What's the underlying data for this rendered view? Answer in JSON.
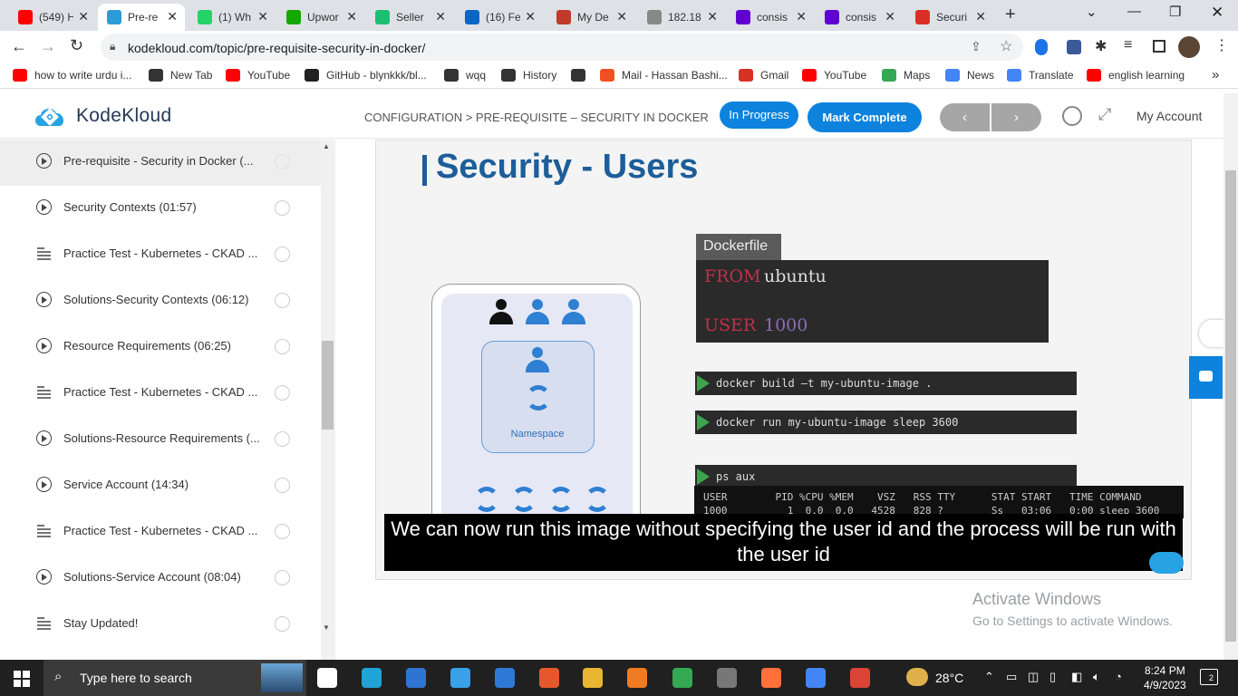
{
  "browser": {
    "tabs": [
      {
        "title": "(549) H",
        "fav": "youtube",
        "color": "#ff0000"
      },
      {
        "title": "Pre-re",
        "fav": "kodekloud",
        "color": "#2b9cd8",
        "active": true
      },
      {
        "title": "(1) Wh",
        "fav": "whatsapp",
        "color": "#25d366"
      },
      {
        "title": "Upwor",
        "fav": "upwork",
        "color": "#14a800"
      },
      {
        "title": "Seller",
        "fav": "fiverr",
        "color": "#1dbf73"
      },
      {
        "title": "(16) Fe",
        "fav": "linkedin",
        "color": "#0a66c2"
      },
      {
        "title": "My De",
        "fav": "site",
        "color": "#c0392b"
      },
      {
        "title": "182.18",
        "fav": "globe",
        "color": "#888888"
      },
      {
        "title": "consis",
        "fav": "yahoo",
        "color": "#6001d2"
      },
      {
        "title": "consis",
        "fav": "yahoo",
        "color": "#6001d2"
      },
      {
        "title": "Securi",
        "fav": "gmail",
        "color": "#d93025"
      }
    ],
    "url": "kodekloud.com/topic/pre-requisite-security-in-docker/",
    "bookmarks": [
      {
        "label": "how to write urdu i...",
        "color": "#ff0000"
      },
      {
        "label": "New Tab",
        "color": "#333333"
      },
      {
        "label": "YouTube",
        "color": "#ff0000"
      },
      {
        "label": "GitHub - blynkkk/bl...",
        "color": "#222222"
      },
      {
        "label": "wqq",
        "color": "#333333"
      },
      {
        "label": "History",
        "color": "#333333"
      },
      {
        "label": "",
        "color": "#333333"
      },
      {
        "label": "Mail - Hassan Bashi...",
        "color": "#f25022"
      },
      {
        "label": "Gmail",
        "color": "#d93025"
      },
      {
        "label": "YouTube",
        "color": "#ff0000"
      },
      {
        "label": "Maps",
        "color": "#34a853"
      },
      {
        "label": "News",
        "color": "#4285f4"
      },
      {
        "label": "Translate",
        "color": "#4285f4"
      },
      {
        "label": "english learning",
        "color": "#ff0000"
      }
    ]
  },
  "header": {
    "logo": "KodeKloud",
    "breadcrumb": "CONFIGURATION > PRE-REQUISITE – SECURITY IN DOCKER",
    "status_badge": "In Progress",
    "mark_complete": "Mark Complete",
    "prev": "‹",
    "next": "›",
    "account": "My Account"
  },
  "sidebar": {
    "items": [
      {
        "label": "Pre-requisite - Security in Docker (...",
        "type": "video",
        "selected": true
      },
      {
        "label": "Security Contexts (01:57)",
        "type": "video"
      },
      {
        "label": "Practice Test - Kubernetes - CKAD ...",
        "type": "text"
      },
      {
        "label": "Solutions-Security Contexts (06:12)",
        "type": "video"
      },
      {
        "label": "Resource Requirements (06:25)",
        "type": "video"
      },
      {
        "label": "Practice Test - Kubernetes - CKAD ...",
        "type": "text"
      },
      {
        "label": "Solutions-Resource Requirements (...",
        "type": "video"
      },
      {
        "label": "Service Account (14:34)",
        "type": "video"
      },
      {
        "label": "Practice Test - Kubernetes - CKAD ...",
        "type": "text"
      },
      {
        "label": "Solutions-Service Account (08:04)",
        "type": "video"
      },
      {
        "label": "Stay Updated!",
        "type": "text"
      }
    ]
  },
  "slide": {
    "title": "Security - Users",
    "dockerfile_label": "Dockerfile",
    "from_kw": "FROM",
    "from_val": "ubuntu",
    "user_kw": "USER",
    "user_val": "1000",
    "cmd1": "docker build –t my-ubuntu-image .",
    "cmd2": "docker run my-ubuntu-image sleep 3600",
    "cmd3": "ps aux",
    "ps_header": "USER        PID %CPU %MEM    VSZ   RSS TTY      STAT START   TIME COMMAND",
    "ps_row": "1000          1  0.0  0.0   4528   828 ?        Ss   03:06   0:00 sleep 3600",
    "namespace": "Namespace",
    "subtitle": "We can now run this image without specifying the user id and the process will be run with the user id"
  },
  "watermark": {
    "line1": "Activate Windows",
    "line2": "Go to Settings to activate Windows."
  },
  "taskbar": {
    "search_placeholder": "Type here to search",
    "temperature": "28°C",
    "time": "8:24 PM",
    "date": "4/9/2023",
    "notifications": "2"
  }
}
